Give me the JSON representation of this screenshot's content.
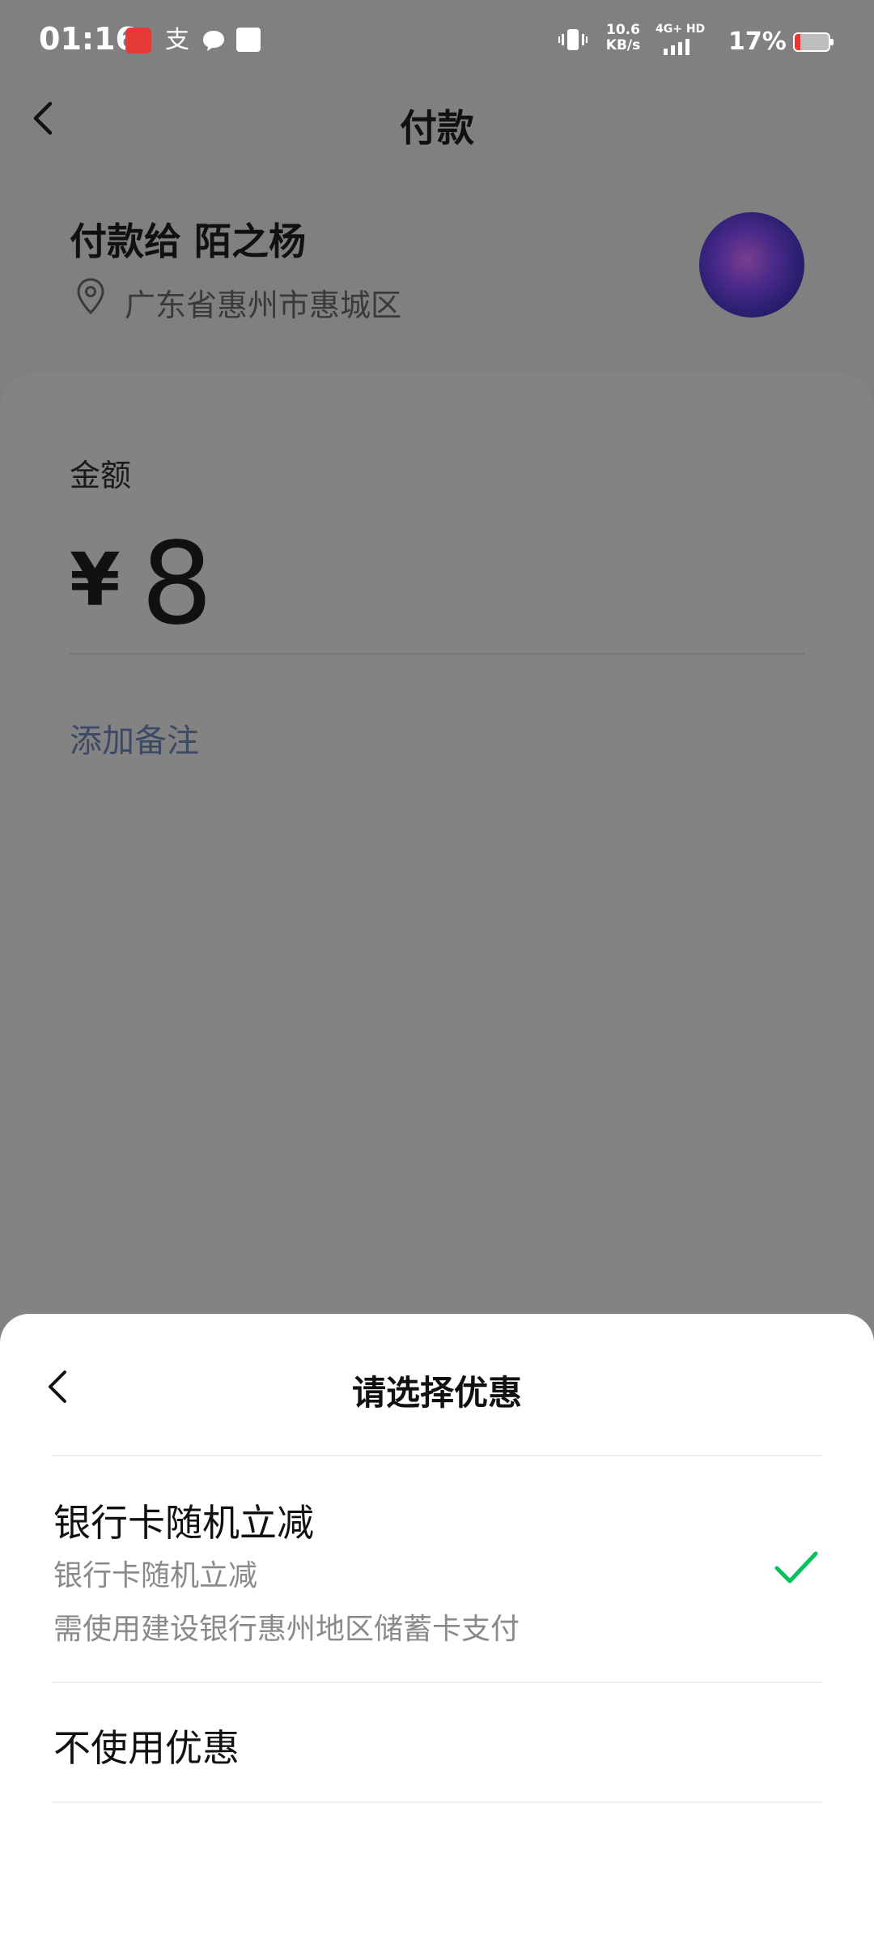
{
  "status_bar": {
    "time": "01:16",
    "speed_value": "10.6",
    "speed_unit": "KB/s",
    "network": "4G+ HD",
    "battery": "17%",
    "icons": [
      "app-red-icon",
      "alipay-icon",
      "message-icon",
      "square-app-icon",
      "vibrate-icon",
      "signal-icon",
      "battery-icon"
    ]
  },
  "header": {
    "title": "付款"
  },
  "payee": {
    "label": "付款给 陌之杨",
    "location": "广东省惠州市惠城区"
  },
  "amount": {
    "label": "金额",
    "currency": "¥",
    "value": "8"
  },
  "remark": {
    "link": "添加备注"
  },
  "sheet": {
    "title": "请选择优惠",
    "options": [
      {
        "title": "银行卡随机立减",
        "subtitle": "银行卡随机立减",
        "description": "需使用建设银行惠州地区储蓄卡支付",
        "selected": true
      },
      {
        "title": "不使用优惠",
        "selected": false
      }
    ]
  },
  "colors": {
    "overlay_bg": "#808080",
    "accent_green": "#07c160",
    "link": "#3c4a66"
  }
}
